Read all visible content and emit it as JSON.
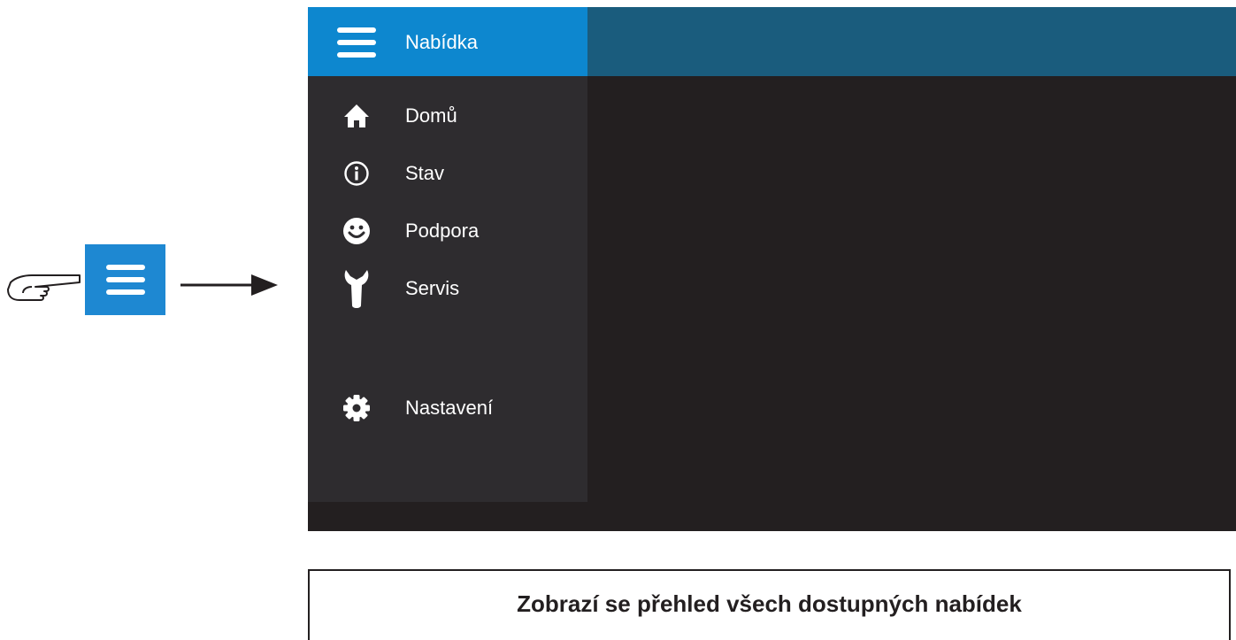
{
  "colors": {
    "accent_blue": "#0d87cf",
    "topbar": "#1a5c7d",
    "drawer": "#2e2c2f",
    "screen": "#231f20"
  },
  "annotation": {
    "hand_icon": "pointing-hand-icon",
    "button_icon": "hamburger-menu-icon",
    "arrow_icon": "arrow-right-icon"
  },
  "drawer": {
    "header_title": "Nabídka",
    "header_icon": "hamburger-menu-icon",
    "items": [
      {
        "label": "Domů",
        "icon": "home-icon"
      },
      {
        "label": "Stav",
        "icon": "info-icon"
      },
      {
        "label": "Podpora",
        "icon": "smiley-icon"
      },
      {
        "label": "Servis",
        "icon": "wrench-icon"
      },
      {
        "label": "Nastavení",
        "icon": "gear-icon"
      }
    ]
  },
  "caption": "Zobrazí se přehled všech dostupných nabídek"
}
